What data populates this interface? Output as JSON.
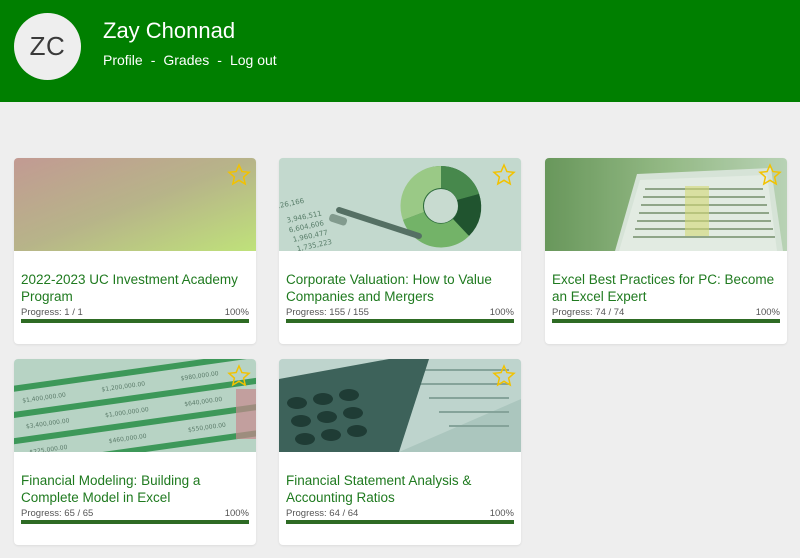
{
  "user": {
    "initials": "ZC",
    "name": "Zay Chonnad",
    "nav": [
      "Profile",
      "Grades",
      "Log out"
    ],
    "separator": "-"
  },
  "colors": {
    "header": "#007f00",
    "title": "#1f7a1f",
    "progress": "#2e6b24",
    "star": "#f2c200"
  },
  "courses": [
    {
      "title": "2022-2023 UC Investment Academy Program",
      "progress_label": "Progress: 1 / 1",
      "percent_label": "100%",
      "progress": 1.0,
      "image_icon": "gradient-thumbnail",
      "favorite_icon": "star-outline-icon"
    },
    {
      "title": "Corporate Valuation: How to Value Companies and Mergers",
      "progress_label": "Progress: 155 / 155",
      "percent_label": "100%",
      "progress": 1.0,
      "image_icon": "donut-chart-photo",
      "favorite_icon": "star-outline-icon"
    },
    {
      "title": "Excel Best Practices for PC: Become an Excel Expert",
      "progress_label": "Progress: 74 / 74",
      "percent_label": "100%",
      "progress": 1.0,
      "image_icon": "laptop-spreadsheet-photo",
      "favorite_icon": "star-outline-icon"
    },
    {
      "title": "Financial Modeling: Building a Complete Model in Excel",
      "progress_label": "Progress: 65 / 65",
      "percent_label": "100%",
      "progress": 1.0,
      "image_icon": "spreadsheet-printout-photo",
      "favorite_icon": "star-outline-icon"
    },
    {
      "title": "Financial Statement Analysis & Accounting Ratios",
      "progress_label": "Progress: 64 / 64",
      "percent_label": "100%",
      "progress": 1.0,
      "image_icon": "calculator-photo",
      "favorite_icon": "star-outline-icon"
    }
  ]
}
